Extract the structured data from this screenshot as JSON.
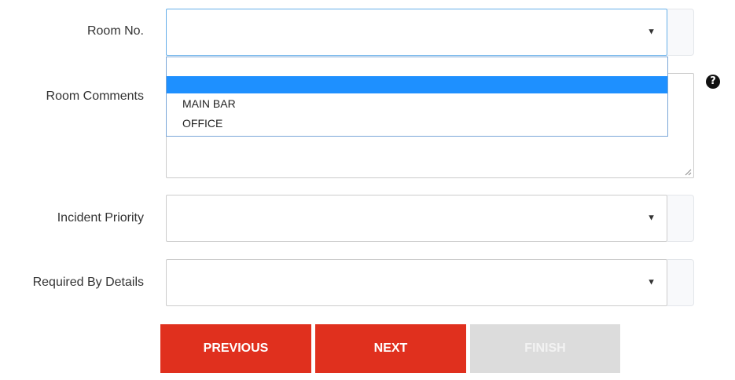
{
  "form": {
    "room_no": {
      "label": "Room No.",
      "value": "",
      "options": [
        "",
        "MAIN BAR",
        "OFFICE"
      ],
      "highlighted_index": 0
    },
    "room_comments": {
      "label": "Room Comments",
      "value": ""
    },
    "incident_priority": {
      "label": "Incident Priority",
      "value": ""
    },
    "required_by_details": {
      "label": "Required By Details",
      "value": ""
    }
  },
  "icons": {
    "caret": "▼",
    "help": "?"
  },
  "buttons": {
    "previous": "PREVIOUS",
    "next": "NEXT",
    "finish": "FINISH"
  },
  "colors": {
    "primary_button": "#e0301e",
    "disabled_button": "#dcdcdc",
    "option_highlight": "#1e90ff",
    "focus_border": "#66afe9"
  }
}
